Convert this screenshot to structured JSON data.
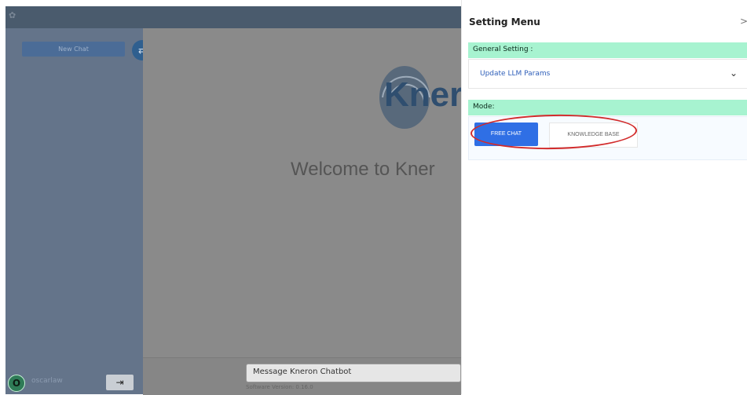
{
  "app": {
    "brand": "Kner",
    "welcome": "Welcome to Kner",
    "new_chat": "New Chat",
    "username": "oscarlaw",
    "avatar_letter": "O",
    "message_placeholder": "Message Kneron Chatbot",
    "software_version": "Software Version: 0.16.0",
    "icons": {
      "logo": "kneron-logo-icon",
      "swap": "swap-icon",
      "logout": "logout-icon"
    }
  },
  "settings_panel": {
    "title": "Setting Menu",
    "close_symbol": ">",
    "general_setting_label": "General Setting :",
    "update_llm_params": "Update LLM Params",
    "mode_label": "Mode:",
    "modes": [
      {
        "label": "FREE CHAT",
        "selected": true
      },
      {
        "label": "KNOWLEDGE BASE",
        "selected": false
      }
    ],
    "colors": {
      "section_bg": "#a7f3d0",
      "primary": "#2f6fe5",
      "highlight": "#d22b2b"
    }
  }
}
